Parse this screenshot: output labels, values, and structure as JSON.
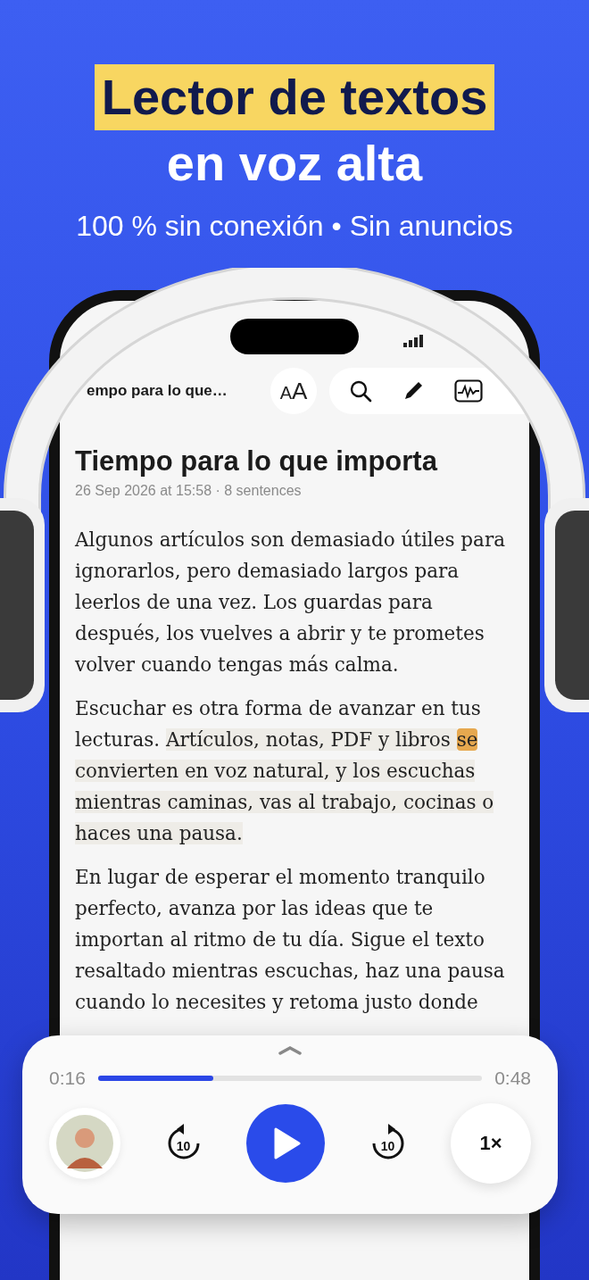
{
  "headline": {
    "highlighted": "Lector de textos",
    "line2": "en voz alta"
  },
  "subtitle": "100 % sin conexión • Sin anuncios",
  "toolbar": {
    "title": "empo para lo que…",
    "text_size_button": "AA"
  },
  "article": {
    "title": "Tiempo para lo que importa",
    "meta": "26 Sep 2026 at 15:58 · 8 sentences",
    "paragraphs": [
      {
        "segments": [
          {
            "kind": "plain",
            "text": "Algunos artículos son demasiado útiles para ignorarlos, pero demasiado largos para leerlos de una vez. Los guardas para después, los vuelves a abrir y te prometes volver cuando tengas más calma."
          }
        ]
      },
      {
        "segments": [
          {
            "kind": "plain",
            "text": "Escuchar es otra forma de avanzar en tus lecturas. "
          },
          {
            "kind": "sentence",
            "text": "Artículos, notas, PDF y libros "
          },
          {
            "kind": "word",
            "text": "se"
          },
          {
            "kind": "sentence",
            "text": " convierten en voz natural, y los escuchas mientras caminas, vas al trabajo, cocinas o haces una pausa."
          }
        ]
      },
      {
        "segments": [
          {
            "kind": "plain",
            "text": "En lugar de esperar el momento tranquilo perfecto, avanza por las ideas que te importan al ritmo de tu día. Sigue el texto resaltado mientras escuchas, haz una pausa cuando lo necesites y retoma justo donde"
          }
        ]
      }
    ]
  },
  "player": {
    "elapsed": "0:16",
    "total": "0:48",
    "level": 0.3,
    "playing": false,
    "skip_back": "10",
    "skip_forward": "10",
    "speed": "1×"
  }
}
